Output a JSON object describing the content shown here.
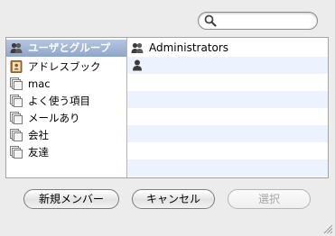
{
  "search": {
    "value": "",
    "placeholder": ""
  },
  "sources": [
    {
      "label": "ユーザとグループ",
      "icon": "users-icon",
      "selected": true
    },
    {
      "label": "アドレスブック",
      "icon": "address-book-icon",
      "selected": false
    },
    {
      "label": "mac",
      "icon": "group-card-icon",
      "selected": false
    },
    {
      "label": "よく使う項目",
      "icon": "group-card-icon",
      "selected": false
    },
    {
      "label": "メールあり",
      "icon": "group-card-icon",
      "selected": false
    },
    {
      "label": "会社",
      "icon": "group-card-icon",
      "selected": false
    },
    {
      "label": "友達",
      "icon": "group-card-icon",
      "selected": false
    }
  ],
  "members": [
    {
      "label": "Administrators",
      "icon": "group-icon"
    },
    {
      "label": "",
      "icon": "user-icon"
    }
  ],
  "buttons": {
    "new_member": "新規メンバー",
    "cancel": "キャンセル",
    "select": "選択"
  },
  "colors": {
    "selection": "#9fb4d6",
    "stripe": "#edf3fe"
  }
}
